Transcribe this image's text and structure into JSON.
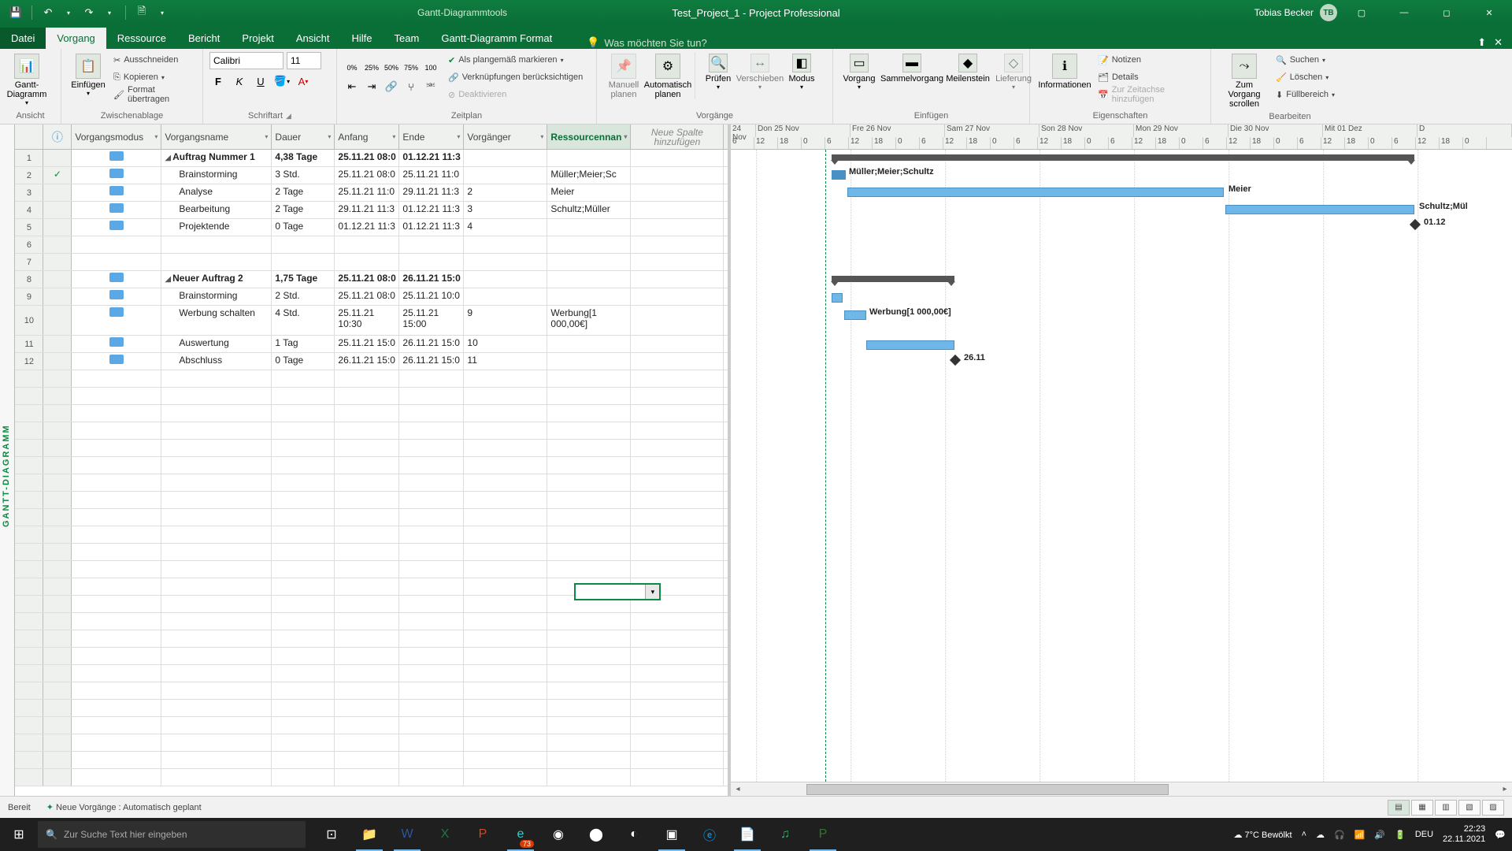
{
  "titlebar": {
    "tool_context": "Gantt-Diagrammtools",
    "document": "Test_Project_1  -  Project Professional",
    "user_name": "Tobias Becker",
    "user_initials": "TB"
  },
  "menu": {
    "file": "Datei",
    "tabs": [
      "Vorgang",
      "Ressource",
      "Bericht",
      "Projekt",
      "Ansicht",
      "Hilfe",
      "Team",
      "Gantt-Diagramm Format"
    ],
    "tellme": "Was möchten Sie tun?"
  },
  "ribbon": {
    "view": {
      "gantt": "Gantt-\nDiagramm",
      "group": "Ansicht"
    },
    "clipboard": {
      "paste": "Einfügen",
      "cut": "Ausschneiden",
      "copy": "Kopieren",
      "format": "Format übertragen",
      "group": "Zwischenablage"
    },
    "font": {
      "name": "Calibri",
      "size": "11",
      "group": "Schriftart"
    },
    "schedule": {
      "mark_ontrack": "Als plangemäß markieren",
      "respect_links": "Verknüpfungen berücksichtigen",
      "deactivate": "Deaktivieren",
      "group": "Zeitplan"
    },
    "tasks": {
      "manual": "Manuell\nplanen",
      "auto": "Automatisch\nplanen",
      "inspect": "Prüfen",
      "move": "Verschieben",
      "mode": "Modus",
      "group": "Vorgänge"
    },
    "insert": {
      "task": "Vorgang",
      "summary": "Sammelvorgang",
      "milestone": "Meilenstein",
      "deliverable": "Lieferung",
      "group": "Einfügen"
    },
    "properties": {
      "info": "Informationen",
      "notes": "Notizen",
      "details": "Details",
      "timeline": "Zur Zeitachse hinzufügen",
      "group": "Eigenschaften"
    },
    "editing": {
      "scroll": "Zum Vorgang\nscrollen",
      "find": "Suchen",
      "clear": "Löschen",
      "fill": "Füllbereich",
      "group": "Bearbeiten"
    }
  },
  "grid": {
    "columns": {
      "mode": "Vorgangsmodus",
      "name": "Vorgangsname",
      "dur": "Dauer",
      "start": "Anfang",
      "end": "Ende",
      "pred": "Vorgänger",
      "res": "Ressourcennan",
      "new": "Neue Spalte hinzufügen"
    },
    "rows": [
      {
        "n": 1,
        "ind": "",
        "summary": true,
        "name": "Auftrag Nummer 1",
        "dur": "4,38 Tage",
        "start": "25.11.21 08:0",
        "end": "01.12.21 11:3",
        "pred": "",
        "res": ""
      },
      {
        "n": 2,
        "ind": "✓",
        "name": "Brainstorming",
        "dur": "3 Std.",
        "start": "25.11.21 08:0",
        "end": "25.11.21 11:0",
        "pred": "",
        "res": "Müller;Meier;Sc"
      },
      {
        "n": 3,
        "ind": "",
        "name": "Analyse",
        "dur": "2 Tage",
        "start": "25.11.21 11:0",
        "end": "29.11.21 11:3",
        "pred": "2",
        "res": "Meier"
      },
      {
        "n": 4,
        "ind": "",
        "name": "Bearbeitung",
        "dur": "2 Tage",
        "start": "29.11.21 11:3",
        "end": "01.12.21 11:3",
        "pred": "3",
        "res": "Schultz;Müller"
      },
      {
        "n": 5,
        "ind": "",
        "name": "Projektende",
        "dur": "0 Tage",
        "start": "01.12.21 11:3",
        "end": "01.12.21 11:3",
        "pred": "4",
        "res": ""
      },
      {
        "n": 6,
        "blank": true
      },
      {
        "n": 7,
        "blank": true
      },
      {
        "n": 8,
        "ind": "",
        "summary": true,
        "name": "Neuer Auftrag 2",
        "dur": "1,75 Tage",
        "start": "25.11.21 08:0",
        "end": "26.11.21 15:0",
        "pred": "",
        "res": ""
      },
      {
        "n": 9,
        "ind": "",
        "name": "Brainstorming",
        "dur": "2 Std.",
        "start": "25.11.21 08:0",
        "end": "25.11.21 10:0",
        "pred": "",
        "res": ""
      },
      {
        "n": 10,
        "ind": "",
        "tall": true,
        "name": "Werbung schalten",
        "dur": "4 Std.",
        "start": "25.11.21 10:30",
        "end": "25.11.21 15:00",
        "pred": "9",
        "res": "Werbung[1 000,00€]"
      },
      {
        "n": 11,
        "ind": "",
        "name": "Auswertung",
        "dur": "1 Tag",
        "start": "25.11.21 15:0",
        "end": "26.11.21 15:0",
        "pred": "10",
        "res": ""
      },
      {
        "n": 12,
        "ind": "",
        "name": "Abschluss",
        "dur": "0 Tage",
        "start": "26.11.21 15:0",
        "end": "26.11.21 15:0",
        "pred": "11",
        "res": ""
      }
    ],
    "sidebar_label": "GANTT-DIAGRAMM"
  },
  "timescale": {
    "days": [
      "24 Nov",
      "Don 25 Nov",
      "Fre 26 Nov",
      "Sam 27 Nov",
      "Son 28 Nov",
      "Mon 29 Nov",
      "Die 30 Nov",
      "Mit 01 Dez",
      "D"
    ],
    "hours": [
      "6",
      "12",
      "18",
      "0",
      "6",
      "12",
      "18",
      "0",
      "6",
      "12",
      "18",
      "0",
      "6",
      "12",
      "18",
      "0",
      "6",
      "12",
      "18",
      "0",
      "6",
      "12",
      "18",
      "0",
      "6",
      "12",
      "18",
      "0",
      "6",
      "12",
      "18",
      "0"
    ]
  },
  "gantt_labels": {
    "r2": "Müller;Meier;Schultz",
    "r3": "Meier",
    "r4": "Schultz;Mül",
    "r5": "01.12",
    "r10": "Werbung[1 000,00€]",
    "r12": "26.11"
  },
  "statusbar": {
    "ready": "Bereit",
    "mode": "Neue Vorgänge : Automatisch geplant"
  },
  "taskbar": {
    "search_placeholder": "Zur Suche Text hier eingeben",
    "weather": "7°C  Bewölkt",
    "lang": "DEU",
    "time": "22:23",
    "date": "22.11.2021",
    "edge_badge": "73"
  }
}
